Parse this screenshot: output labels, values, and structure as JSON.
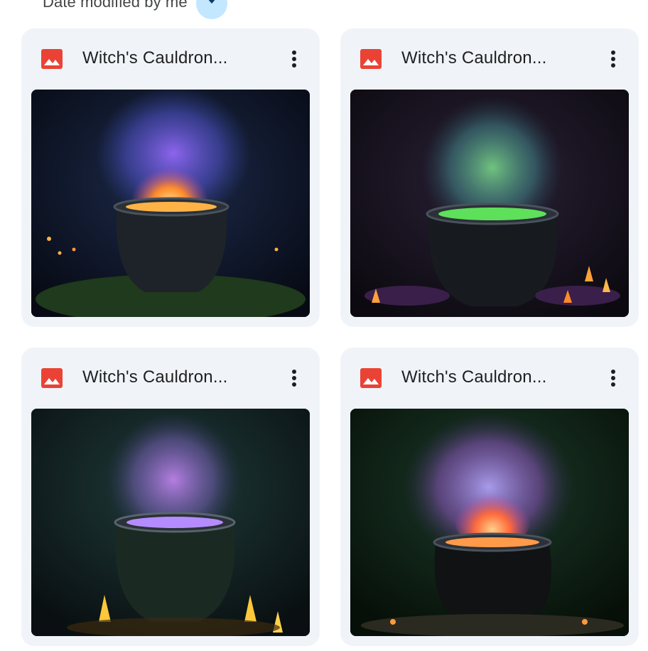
{
  "sort": {
    "label": "Date modified by me",
    "icon": "arrow-down-icon"
  },
  "files": [
    {
      "name": "Witch's Cauldron...",
      "icon": "image-file-icon",
      "accent": "#ea4335",
      "menu_icon": "more-vert-icon"
    },
    {
      "name": "Witch's Cauldron...",
      "icon": "image-file-icon",
      "accent": "#ea4335",
      "menu_icon": "more-vert-icon"
    },
    {
      "name": "Witch's Cauldron...",
      "icon": "image-file-icon",
      "accent": "#ea4335",
      "menu_icon": "more-vert-icon"
    },
    {
      "name": "Witch's Cauldron...",
      "icon": "image-file-icon",
      "accent": "#ea4335",
      "menu_icon": "more-vert-icon"
    }
  ]
}
